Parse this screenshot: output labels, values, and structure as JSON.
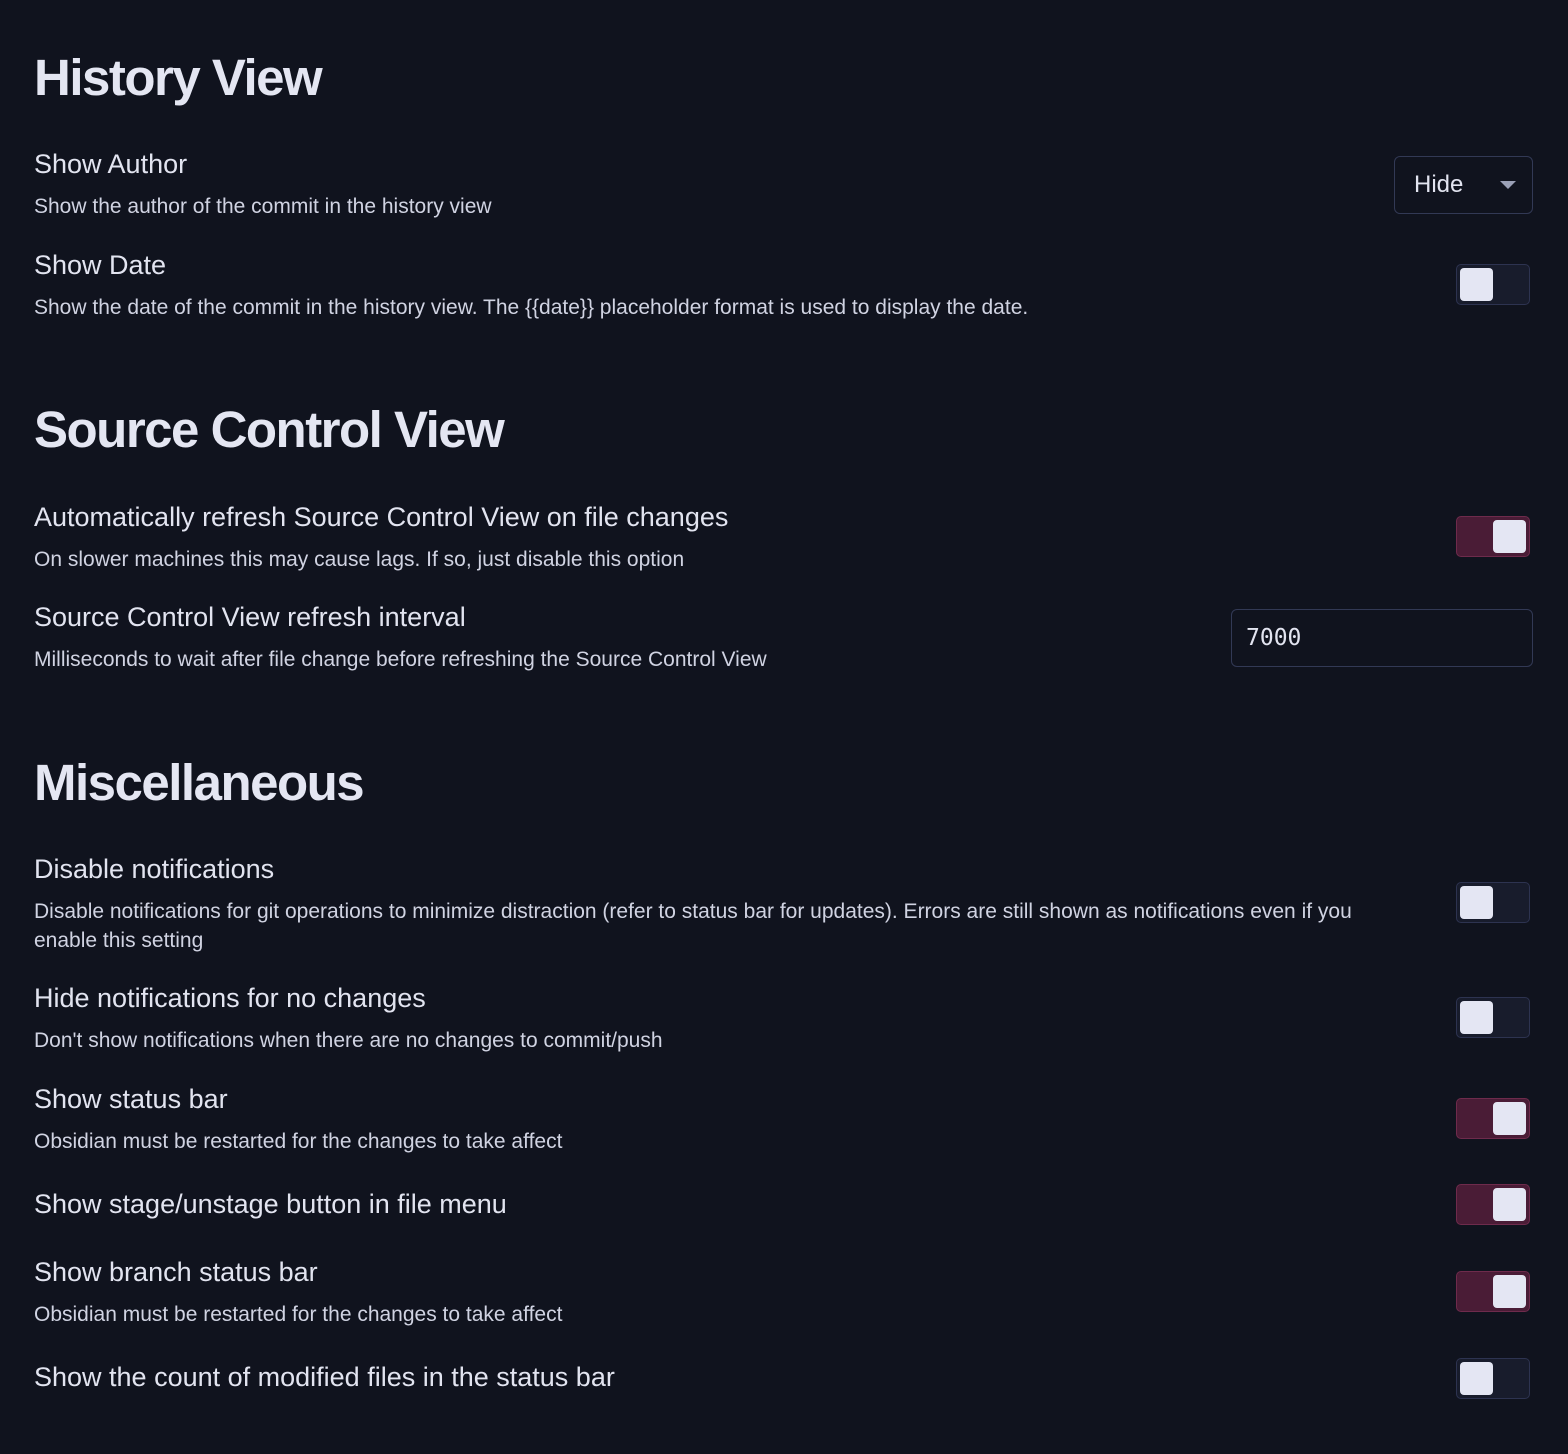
{
  "sections": {
    "history": {
      "title": "History View",
      "show_author": {
        "name": "Show Author",
        "desc": "Show the author of the commit in the history view",
        "dropdown_value": "Hide"
      },
      "show_date": {
        "name": "Show Date",
        "desc": "Show the date of the commit in the history view. The {{date}} placeholder format is used to display the date.",
        "enabled": false
      }
    },
    "source_control": {
      "title": "Source Control View",
      "auto_refresh": {
        "name": "Automatically refresh Source Control View on file changes",
        "desc": "On slower machines this may cause lags. If so, just disable this option",
        "enabled": true
      },
      "refresh_interval": {
        "name": "Source Control View refresh interval",
        "desc": "Milliseconds to wait after file change before refreshing the Source Control View",
        "value": "7000"
      }
    },
    "misc": {
      "title": "Miscellaneous",
      "disable_notifications": {
        "name": "Disable notifications",
        "desc": "Disable notifications for git operations to minimize distraction (refer to status bar for updates). Errors are still shown as notifications even if you enable this setting",
        "enabled": false
      },
      "hide_no_changes": {
        "name": "Hide notifications for no changes",
        "desc": "Don't show notifications when there are no changes to commit/push",
        "enabled": false
      },
      "show_status_bar": {
        "name": "Show status bar",
        "desc": "Obsidian must be restarted for the changes to take affect",
        "enabled": true
      },
      "show_stage_button": {
        "name": "Show stage/unstage button in file menu",
        "enabled": true
      },
      "show_branch_status_bar": {
        "name": "Show branch status bar",
        "desc": "Obsidian must be restarted for the changes to take affect",
        "enabled": true
      },
      "show_modified_count": {
        "name": "Show the count of modified files in the status bar",
        "enabled": false
      }
    }
  },
  "colors": {
    "background": "#10131e",
    "toggle_on": "#4a1c36",
    "toggle_off": "#181c2c",
    "knob": "#e4e6f3"
  }
}
